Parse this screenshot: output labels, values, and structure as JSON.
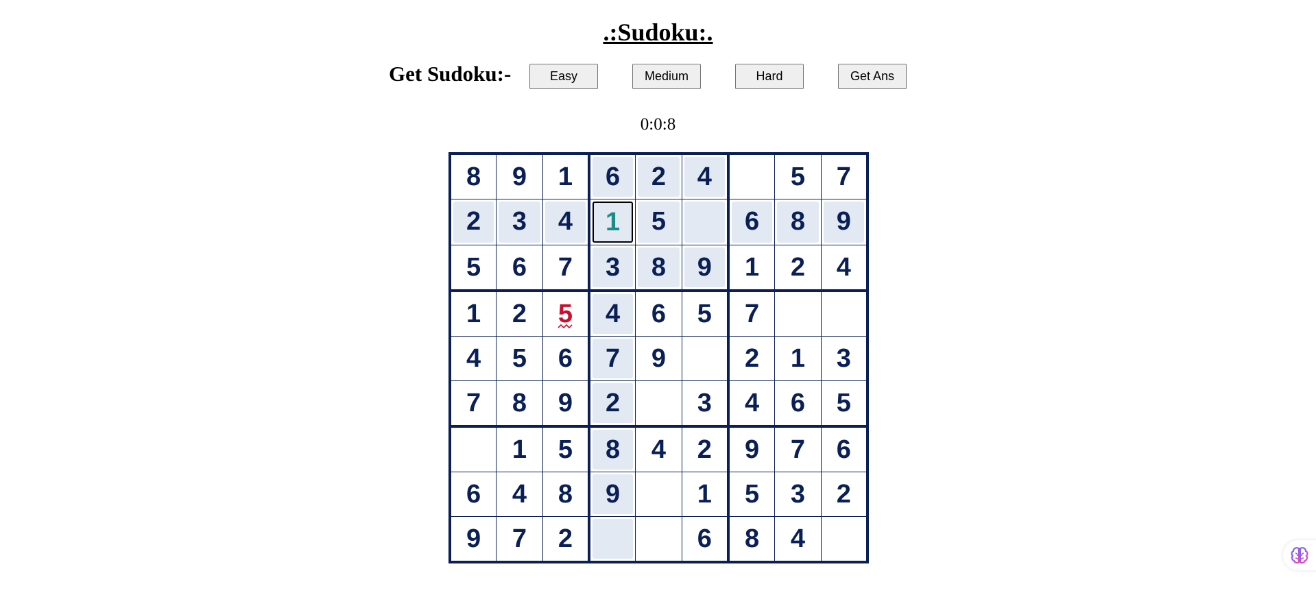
{
  "page_title": ".:Sudoku:.",
  "controls": {
    "label": "Get Sudoku:-",
    "buttons": [
      {
        "id": "easy",
        "label": "Easy"
      },
      {
        "id": "medium",
        "label": "Medium"
      },
      {
        "id": "hard",
        "label": "Hard"
      },
      {
        "id": "get-ans",
        "label": "Get Ans"
      }
    ]
  },
  "timer": "0:0:8",
  "board": {
    "selected": [
      1,
      3
    ],
    "errors": [
      [
        3,
        2
      ]
    ],
    "rows": [
      [
        "8",
        "9",
        "1",
        "6",
        "2",
        "4",
        "",
        "5",
        "7"
      ],
      [
        "2",
        "3",
        "4",
        "1",
        "5",
        "",
        "6",
        "8",
        "9"
      ],
      [
        "5",
        "6",
        "7",
        "3",
        "8",
        "9",
        "1",
        "2",
        "4"
      ],
      [
        "1",
        "2",
        "5",
        "4",
        "6",
        "5",
        "7",
        "",
        ""
      ],
      [
        "4",
        "5",
        "6",
        "7",
        "9",
        "",
        "2",
        "1",
        "3"
      ],
      [
        "7",
        "8",
        "9",
        "2",
        "",
        "3",
        "4",
        "6",
        "5"
      ],
      [
        "",
        "1",
        "5",
        "8",
        "4",
        "2",
        "9",
        "7",
        "6"
      ],
      [
        "6",
        "4",
        "8",
        "9",
        "",
        "1",
        "5",
        "3",
        "2"
      ],
      [
        "9",
        "7",
        "2",
        "",
        "",
        "6",
        "8",
        "4",
        ""
      ]
    ]
  },
  "colors": {
    "digit": "#0a1f55",
    "selected_digit": "#1c8c86",
    "error_digit": "#c8102e",
    "highlight": "#e2e9f3"
  },
  "extension_icon": "brain-icon"
}
